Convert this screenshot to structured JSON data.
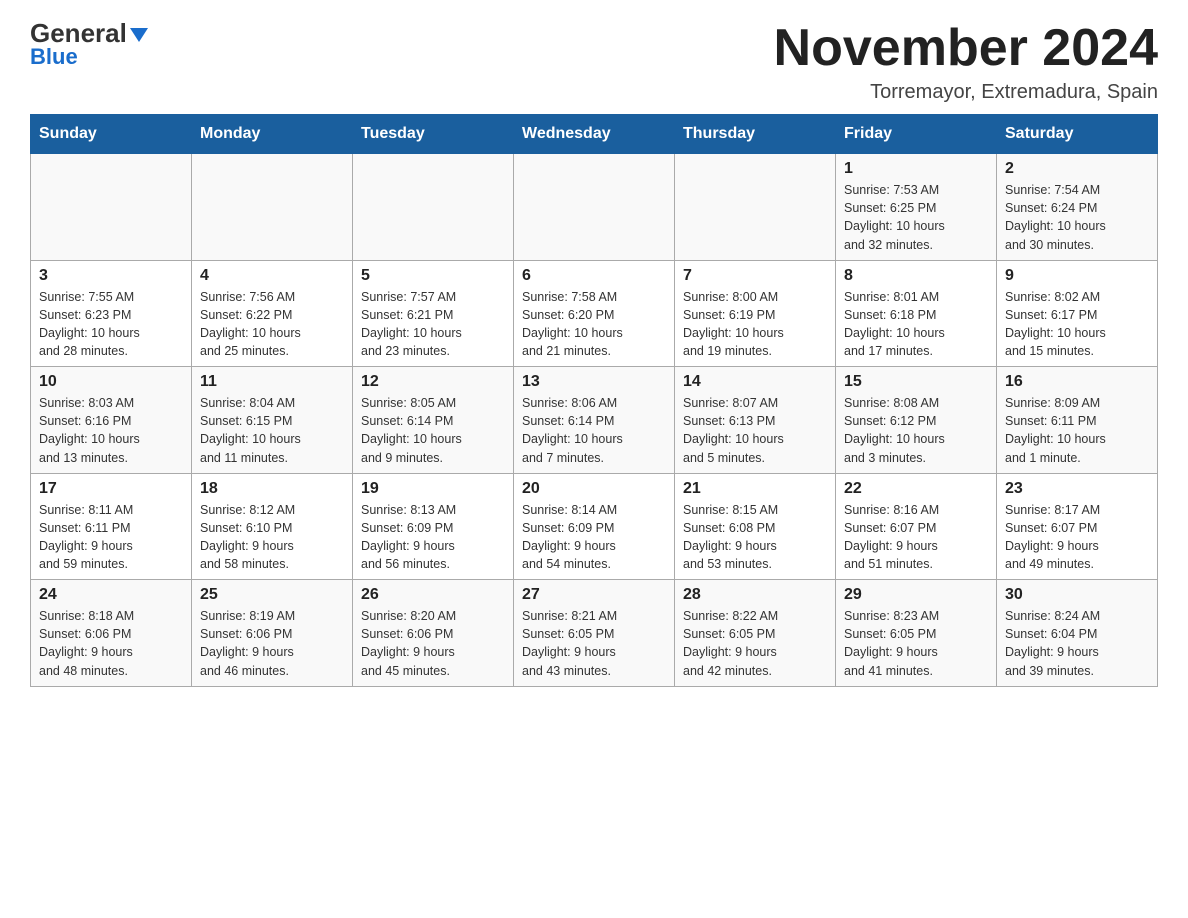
{
  "header": {
    "logo": {
      "general": "General",
      "blue": "Blue"
    },
    "title": "November 2024",
    "location": "Torremayor, Extremadura, Spain"
  },
  "columns": [
    "Sunday",
    "Monday",
    "Tuesday",
    "Wednesday",
    "Thursday",
    "Friday",
    "Saturday"
  ],
  "weeks": [
    [
      {
        "day": "",
        "info": ""
      },
      {
        "day": "",
        "info": ""
      },
      {
        "day": "",
        "info": ""
      },
      {
        "day": "",
        "info": ""
      },
      {
        "day": "",
        "info": ""
      },
      {
        "day": "1",
        "info": "Sunrise: 7:53 AM\nSunset: 6:25 PM\nDaylight: 10 hours\nand 32 minutes."
      },
      {
        "day": "2",
        "info": "Sunrise: 7:54 AM\nSunset: 6:24 PM\nDaylight: 10 hours\nand 30 minutes."
      }
    ],
    [
      {
        "day": "3",
        "info": "Sunrise: 7:55 AM\nSunset: 6:23 PM\nDaylight: 10 hours\nand 28 minutes."
      },
      {
        "day": "4",
        "info": "Sunrise: 7:56 AM\nSunset: 6:22 PM\nDaylight: 10 hours\nand 25 minutes."
      },
      {
        "day": "5",
        "info": "Sunrise: 7:57 AM\nSunset: 6:21 PM\nDaylight: 10 hours\nand 23 minutes."
      },
      {
        "day": "6",
        "info": "Sunrise: 7:58 AM\nSunset: 6:20 PM\nDaylight: 10 hours\nand 21 minutes."
      },
      {
        "day": "7",
        "info": "Sunrise: 8:00 AM\nSunset: 6:19 PM\nDaylight: 10 hours\nand 19 minutes."
      },
      {
        "day": "8",
        "info": "Sunrise: 8:01 AM\nSunset: 6:18 PM\nDaylight: 10 hours\nand 17 minutes."
      },
      {
        "day": "9",
        "info": "Sunrise: 8:02 AM\nSunset: 6:17 PM\nDaylight: 10 hours\nand 15 minutes."
      }
    ],
    [
      {
        "day": "10",
        "info": "Sunrise: 8:03 AM\nSunset: 6:16 PM\nDaylight: 10 hours\nand 13 minutes."
      },
      {
        "day": "11",
        "info": "Sunrise: 8:04 AM\nSunset: 6:15 PM\nDaylight: 10 hours\nand 11 minutes."
      },
      {
        "day": "12",
        "info": "Sunrise: 8:05 AM\nSunset: 6:14 PM\nDaylight: 10 hours\nand 9 minutes."
      },
      {
        "day": "13",
        "info": "Sunrise: 8:06 AM\nSunset: 6:14 PM\nDaylight: 10 hours\nand 7 minutes."
      },
      {
        "day": "14",
        "info": "Sunrise: 8:07 AM\nSunset: 6:13 PM\nDaylight: 10 hours\nand 5 minutes."
      },
      {
        "day": "15",
        "info": "Sunrise: 8:08 AM\nSunset: 6:12 PM\nDaylight: 10 hours\nand 3 minutes."
      },
      {
        "day": "16",
        "info": "Sunrise: 8:09 AM\nSunset: 6:11 PM\nDaylight: 10 hours\nand 1 minute."
      }
    ],
    [
      {
        "day": "17",
        "info": "Sunrise: 8:11 AM\nSunset: 6:11 PM\nDaylight: 9 hours\nand 59 minutes."
      },
      {
        "day": "18",
        "info": "Sunrise: 8:12 AM\nSunset: 6:10 PM\nDaylight: 9 hours\nand 58 minutes."
      },
      {
        "day": "19",
        "info": "Sunrise: 8:13 AM\nSunset: 6:09 PM\nDaylight: 9 hours\nand 56 minutes."
      },
      {
        "day": "20",
        "info": "Sunrise: 8:14 AM\nSunset: 6:09 PM\nDaylight: 9 hours\nand 54 minutes."
      },
      {
        "day": "21",
        "info": "Sunrise: 8:15 AM\nSunset: 6:08 PM\nDaylight: 9 hours\nand 53 minutes."
      },
      {
        "day": "22",
        "info": "Sunrise: 8:16 AM\nSunset: 6:07 PM\nDaylight: 9 hours\nand 51 minutes."
      },
      {
        "day": "23",
        "info": "Sunrise: 8:17 AM\nSunset: 6:07 PM\nDaylight: 9 hours\nand 49 minutes."
      }
    ],
    [
      {
        "day": "24",
        "info": "Sunrise: 8:18 AM\nSunset: 6:06 PM\nDaylight: 9 hours\nand 48 minutes."
      },
      {
        "day": "25",
        "info": "Sunrise: 8:19 AM\nSunset: 6:06 PM\nDaylight: 9 hours\nand 46 minutes."
      },
      {
        "day": "26",
        "info": "Sunrise: 8:20 AM\nSunset: 6:06 PM\nDaylight: 9 hours\nand 45 minutes."
      },
      {
        "day": "27",
        "info": "Sunrise: 8:21 AM\nSunset: 6:05 PM\nDaylight: 9 hours\nand 43 minutes."
      },
      {
        "day": "28",
        "info": "Sunrise: 8:22 AM\nSunset: 6:05 PM\nDaylight: 9 hours\nand 42 minutes."
      },
      {
        "day": "29",
        "info": "Sunrise: 8:23 AM\nSunset: 6:05 PM\nDaylight: 9 hours\nand 41 minutes."
      },
      {
        "day": "30",
        "info": "Sunrise: 8:24 AM\nSunset: 6:04 PM\nDaylight: 9 hours\nand 39 minutes."
      }
    ]
  ]
}
